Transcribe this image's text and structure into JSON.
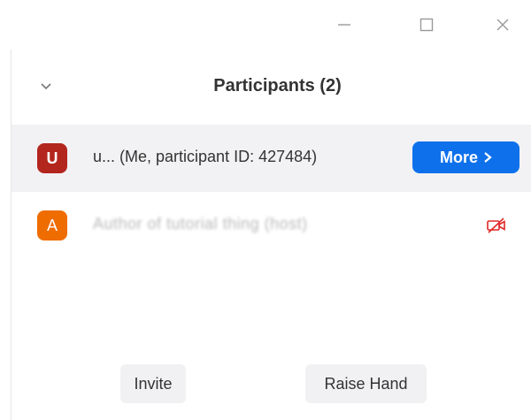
{
  "window": {
    "controls": [
      "minimize-icon",
      "maximize-icon",
      "close-icon"
    ]
  },
  "header": {
    "title": "Participants (2)",
    "collapse_icon": "chevron-down-icon"
  },
  "participants": [
    {
      "initial": "U",
      "name": "u... (Me, participant ID: 427484)",
      "avatar_color": "#b3261e",
      "action_label": "More"
    },
    {
      "initial": "A",
      "name": "Author of tutorial thing (host)",
      "avatar_color": "#ef6c00",
      "status_icon": "video-off-icon"
    }
  ],
  "footer": {
    "invite_label": "Invite",
    "raise_hand_label": "Raise Hand"
  },
  "colors": {
    "accent": "#0e71eb",
    "video_off": "#e02828"
  }
}
